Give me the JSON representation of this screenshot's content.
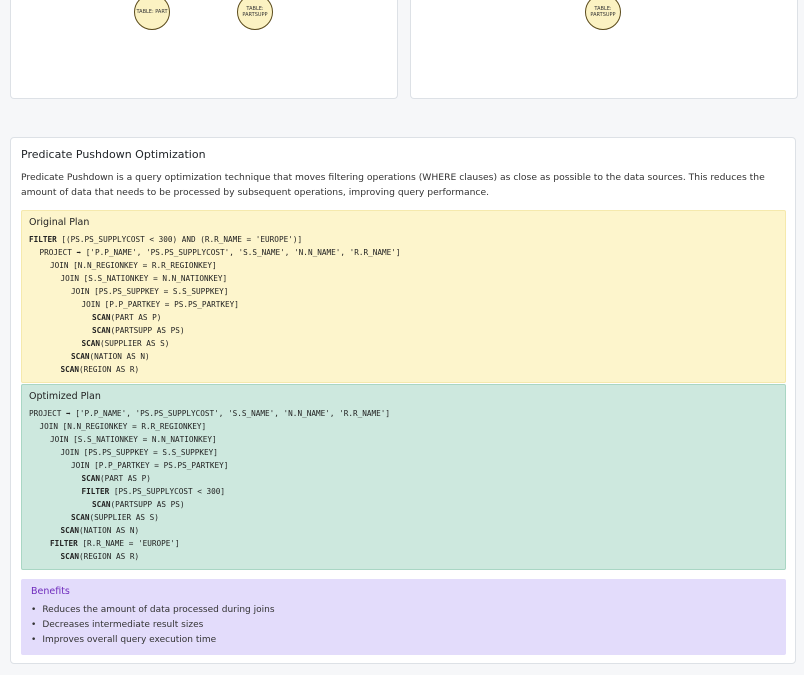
{
  "top_panels": {
    "left_nodes": [
      "TABLE: PART",
      "TABLE: PARTSUPP"
    ],
    "right_nodes": [
      "TABLE: PARTSUPP"
    ]
  },
  "section": {
    "title": "Predicate Pushdown Optimization",
    "description": "Predicate Pushdown is a query optimization technique that moves filtering operations (WHERE clauses) as close as possible to the data sources. This reduces the amount of data that needs to be processed by subsequent operations, improving query performance."
  },
  "original_plan": {
    "title": "Original Plan",
    "lines": [
      {
        "kw": "FILTER",
        "text": " [(PS.PS_SUPPLYCOST < 300) AND (R.R_NAME = 'EUROPE')]",
        "indent": 0
      },
      {
        "kw": "",
        "text": "PROJECT ➡ ['P.P_NAME', 'PS.PS_SUPPLYCOST', 'S.S_NAME', 'N.N_NAME', 'R.R_NAME']",
        "indent": 1
      },
      {
        "kw": "",
        "text": "JOIN [N.N_REGIONKEY = R.R_REGIONKEY]",
        "indent": 2
      },
      {
        "kw": "",
        "text": "JOIN [S.S_NATIONKEY = N.N_NATIONKEY]",
        "indent": 3
      },
      {
        "kw": "",
        "text": "JOIN [PS.PS_SUPPKEY = S.S_SUPPKEY]",
        "indent": 4
      },
      {
        "kw": "",
        "text": "JOIN [P.P_PARTKEY = PS.PS_PARTKEY]",
        "indent": 5
      },
      {
        "kw": "SCAN",
        "text": "(PART AS P)",
        "indent": 6
      },
      {
        "kw": "SCAN",
        "text": "(PARTSUPP AS PS)",
        "indent": 6
      },
      {
        "kw": "SCAN",
        "text": "(SUPPLIER AS S)",
        "indent": 5
      },
      {
        "kw": "SCAN",
        "text": "(NATION AS N)",
        "indent": 4
      },
      {
        "kw": "SCAN",
        "text": "(REGION AS R)",
        "indent": 3
      }
    ]
  },
  "optimized_plan": {
    "title": "Optimized Plan",
    "lines": [
      {
        "kw": "",
        "text": "PROJECT ➡ ['P.P_NAME', 'PS.PS_SUPPLYCOST', 'S.S_NAME', 'N.N_NAME', 'R.R_NAME']",
        "indent": 0
      },
      {
        "kw": "",
        "text": "JOIN [N.N_REGIONKEY = R.R_REGIONKEY]",
        "indent": 1
      },
      {
        "kw": "",
        "text": "JOIN [S.S_NATIONKEY = N.N_NATIONKEY]",
        "indent": 2
      },
      {
        "kw": "",
        "text": "JOIN [PS.PS_SUPPKEY = S.S_SUPPKEY]",
        "indent": 3
      },
      {
        "kw": "",
        "text": "JOIN [P.P_PARTKEY = PS.PS_PARTKEY]",
        "indent": 4
      },
      {
        "kw": "SCAN",
        "text": "(PART AS P)",
        "indent": 5
      },
      {
        "kw": "FILTER",
        "text": " [PS.PS_SUPPLYCOST < 300]",
        "indent": 5
      },
      {
        "kw": "SCAN",
        "text": "(PARTSUPP AS PS)",
        "indent": 6
      },
      {
        "kw": "SCAN",
        "text": "(SUPPLIER AS S)",
        "indent": 4
      },
      {
        "kw": "SCAN",
        "text": "(NATION AS N)",
        "indent": 3
      },
      {
        "kw": "FILTER",
        "text": " [R.R_NAME = 'EUROPE']",
        "indent": 2
      },
      {
        "kw": "SCAN",
        "text": "(REGION AS R)",
        "indent": 3
      }
    ]
  },
  "benefits": {
    "title": "Benefits",
    "items": [
      "Reduces the amount of data processed during joins",
      "Decreases intermediate result sizes",
      "Improves overall query execution time"
    ]
  },
  "colors": {
    "original_bg": "#fdf5cc",
    "optimized_bg": "#cde8de",
    "benefits_bg": "#e3dcfb",
    "benefits_title": "#6f2bbd",
    "node_fill": "#fbf2c2"
  }
}
